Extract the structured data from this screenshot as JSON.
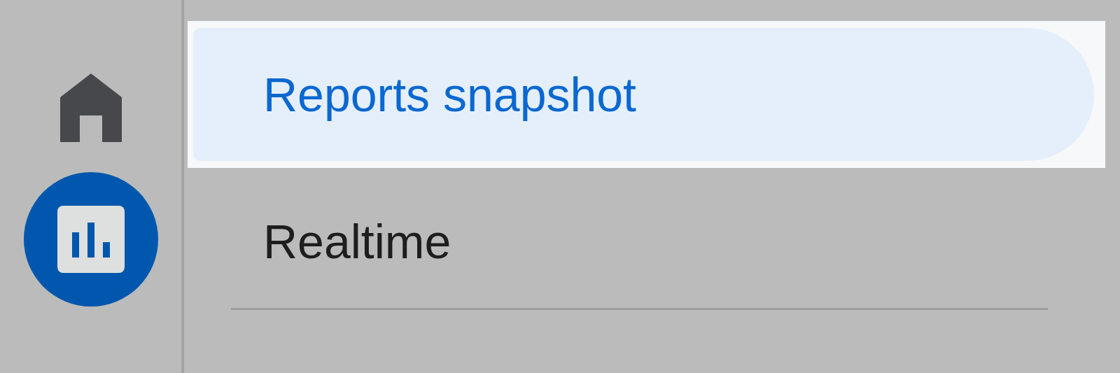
{
  "nav_rail": [
    {
      "kind": "home",
      "selected": false
    },
    {
      "kind": "reports",
      "selected": true
    }
  ],
  "menu": [
    {
      "label": "Reports snapshot",
      "selected": true
    },
    {
      "label": "Realtime",
      "selected": false
    }
  ]
}
